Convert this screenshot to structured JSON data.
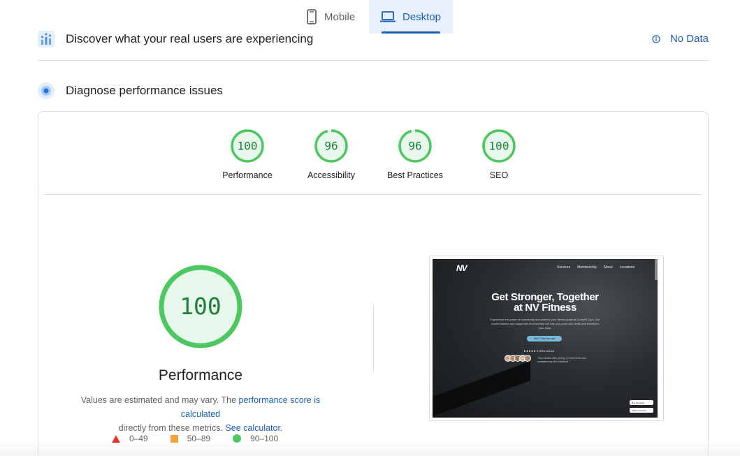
{
  "tabs": [
    {
      "label": "Mobile",
      "icon": "smartphone-icon",
      "active": false
    },
    {
      "label": "Desktop",
      "icon": "laptop-icon",
      "active": true
    }
  ],
  "field_data": {
    "title": "Discover what your real users are experiencing",
    "status": "No Data",
    "status_icon": "info-icon"
  },
  "diagnose": {
    "title": "Diagnose performance issues"
  },
  "scores": [
    {
      "label": "Performance",
      "value": "100",
      "fraction": 1.0
    },
    {
      "label": "Accessibility",
      "value": "96",
      "fraction": 0.96
    },
    {
      "label": "Best Practices",
      "value": "96",
      "fraction": 0.96
    },
    {
      "label": "SEO",
      "value": "100",
      "fraction": 1.0
    }
  ],
  "main_score": {
    "value": "100",
    "fraction": 1.0,
    "title": "Performance",
    "desc_prefix": "Values are estimated and may vary. The ",
    "desc_link1": "performance score is calculated",
    "desc_middle": " directly from these metrics. ",
    "desc_link2": "See calculator."
  },
  "legend": [
    {
      "shape": "triangle",
      "label": "0–49"
    },
    {
      "shape": "square",
      "label": "50–89"
    },
    {
      "shape": "circle",
      "label": "90–100"
    }
  ],
  "screenshot": {
    "logo": "NV",
    "nav": [
      "Services",
      "Membership",
      "About",
      "Locations"
    ],
    "headline_line1": "Get Stronger, Together",
    "headline_line2": "at NV Fitness",
    "paragraph": "Experience the power of community and achieve your fitness goals at CrossFit Gym. Our expert trainers and supportive environment will help you push your limits and transform your body.",
    "button": "Start 7-day free trial",
    "reviews": "★★★★★ 5 300 reviews",
    "quote": "\"Two months after joining, I've lost 15 lbs and completed my first marathon.\"",
    "chip1": "Buy Template",
    "chip2": "Made in Framer"
  },
  "colors": {
    "pass": "#0cce6b",
    "pass_fill": "#e8f7ec",
    "pass_text": "#1e7f3a",
    "accent": "#1a5fb4",
    "average": "#f2a53a",
    "fail": "#e5322d"
  }
}
